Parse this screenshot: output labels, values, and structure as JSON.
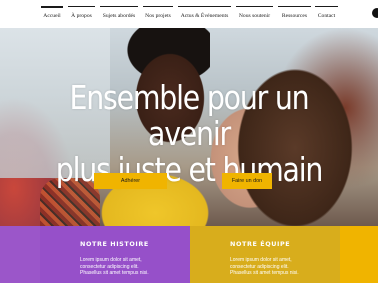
{
  "nav": {
    "items": [
      {
        "label": "Accueil",
        "active": true
      },
      {
        "label": "À propos",
        "active": false
      },
      {
        "label": "Sujets abordés",
        "active": false
      },
      {
        "label": "Nos projets",
        "active": false
      },
      {
        "label": "Actus & Événements",
        "active": false
      },
      {
        "label": "Nous soutenir",
        "active": false
      },
      {
        "label": "Ressources",
        "active": false
      },
      {
        "label": "Contact",
        "active": false
      }
    ]
  },
  "hero": {
    "title_line1": "Ensemble pour un avenir",
    "title_line2": "plus juste et humain",
    "buttons": {
      "join": "Adhérer",
      "donate": "Faire un don"
    }
  },
  "sections": {
    "history": {
      "title": "NOTRE HISTOIRE",
      "text_lines": [
        "Lorem ipsum dolor sit amet,",
        "consectetur adipiscing elit.",
        "Phasellus sit amet tempus nisi."
      ]
    },
    "team": {
      "title": "NOTRE ÉQUIPE",
      "text_lines": [
        "Lorem ipsum dolor sit amet,",
        "consectetur adipiscing elit.",
        "Phasellus sit amet tempus nisi."
      ]
    }
  },
  "colors": {
    "accent_yellow": "#f0b400",
    "purple": "#9650c9",
    "mustard": "#d8ad1c"
  }
}
